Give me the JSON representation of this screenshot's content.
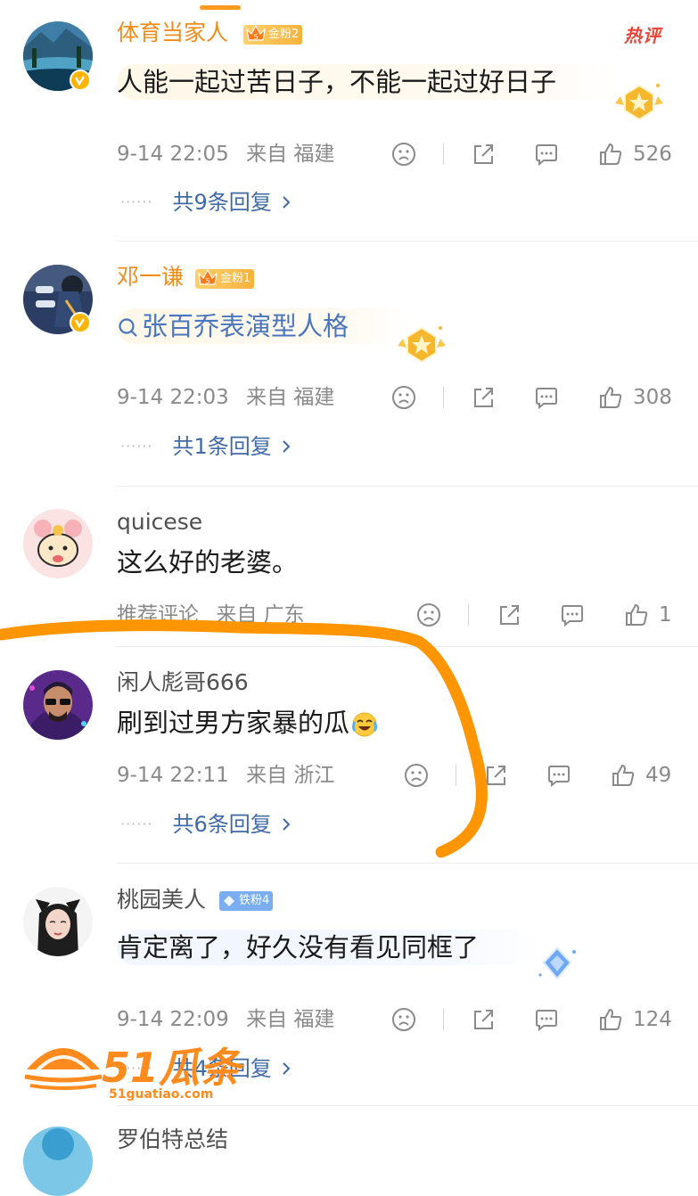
{
  "hot_tag": "热评",
  "comments": [
    {
      "username": "体育当家人",
      "badge_level": "5",
      "badge": "金粉2",
      "text": "人能一起过苦日子，不能一起过好日子",
      "time": "9-14 22:05",
      "location": "来自 福建",
      "likes": "526",
      "replies": "共9条回复"
    },
    {
      "username": "邓一谦",
      "badge_level": "5",
      "badge": "金粉1",
      "text": "张百乔表演型人格",
      "time": "9-14 22:03",
      "location": "来自 福建",
      "likes": "308",
      "replies": "共1条回复"
    },
    {
      "username": "quicese",
      "text": "这么好的老婆。",
      "time": "推荐评论",
      "location": "来自 广东",
      "likes": "1"
    },
    {
      "username": "闲人彪哥666",
      "text": "刷到过男方家暴的瓜",
      "time": "9-14 22:11",
      "location": "来自 浙江",
      "likes": "49",
      "replies": "共6条回复"
    },
    {
      "username": "桃园美人",
      "badge": "铁粉4",
      "text": "肯定离了，好久没有看见同框了",
      "time": "9-14 22:09",
      "location": "来自 福建",
      "likes": "124",
      "replies": "共4条回复"
    },
    {
      "username": "罗伯特总结"
    }
  ],
  "watermark": {
    "brand": "51瓜条",
    "url": "51guatiao.com"
  },
  "colors": {
    "username_gold": "#f08c1a",
    "reply_link": "#3f6aa6",
    "annotation_stroke": "#ff9500",
    "hot_tag": "#ee4336"
  }
}
